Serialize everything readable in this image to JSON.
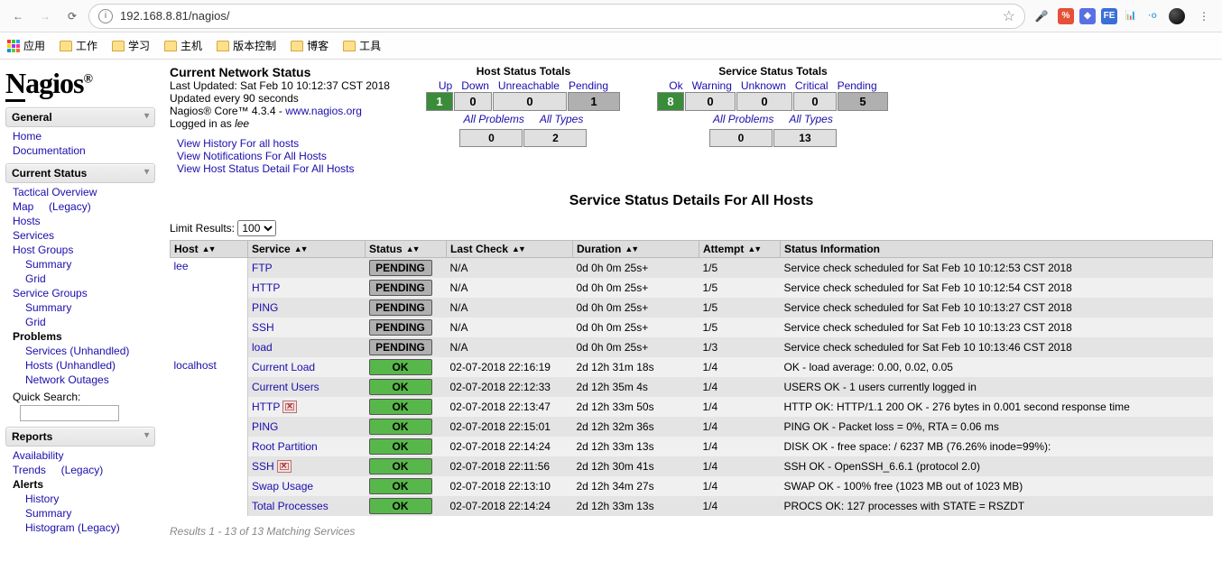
{
  "browser": {
    "url": "192.168.8.81/nagios/",
    "bookmark_label": "应用",
    "bookmarks": [
      "工作",
      "学习",
      "主机",
      "版本控制",
      "博客",
      "工具"
    ]
  },
  "logo": "Nagios",
  "nav": {
    "general": {
      "title": "General",
      "items": [
        "Home",
        "Documentation"
      ]
    },
    "current": {
      "title": "Current Status",
      "items": [
        {
          "label": "Tactical Overview"
        },
        {
          "label": "Map     (Legacy)"
        },
        {
          "label": "Hosts"
        },
        {
          "label": "Services"
        },
        {
          "label": "Host Groups"
        },
        {
          "label": "Summary",
          "sub": true
        },
        {
          "label": "Grid",
          "sub": true
        },
        {
          "label": "Service Groups"
        },
        {
          "label": "Summary",
          "sub": true
        },
        {
          "label": "Grid",
          "sub": true
        },
        {
          "label": "Problems",
          "bold": true
        },
        {
          "label": "Services (Unhandled)",
          "sub": true
        },
        {
          "label": "Hosts (Unhandled)",
          "sub": true
        },
        {
          "label": "Network Outages",
          "sub": true
        }
      ],
      "quick_search": "Quick Search:"
    },
    "reports": {
      "title": "Reports",
      "items": [
        {
          "label": "Availability"
        },
        {
          "label": "Trends     (Legacy)"
        },
        {
          "label": "Alerts",
          "bold": true
        },
        {
          "label": "History",
          "sub": true
        },
        {
          "label": "Summary",
          "sub": true
        },
        {
          "label": "Histogram (Legacy)",
          "sub": true
        }
      ]
    }
  },
  "cns": {
    "title": "Current Network Status",
    "last_updated": "Last Updated: Sat Feb 10 10:12:37 CST 2018",
    "interval": "Updated every 90 seconds",
    "core_prefix": "Nagios® Core™ 4.3.4 - ",
    "core_link": "www.nagios.org",
    "loggedin_prefix": "Logged in as ",
    "loggedin_user": "lee",
    "links": [
      "View History For all hosts",
      "View Notifications For All Hosts",
      "View Host Status Detail For All Hosts"
    ]
  },
  "host_totals": {
    "title": "Host Status Totals",
    "headers": [
      "Up",
      "Down",
      "Unreachable",
      "Pending"
    ],
    "values": [
      "1",
      "0",
      "0",
      "1"
    ],
    "sub_headers": [
      "All Problems",
      "All Types"
    ],
    "sub_values": [
      "0",
      "2"
    ]
  },
  "service_totals": {
    "title": "Service Status Totals",
    "headers": [
      "Ok",
      "Warning",
      "Unknown",
      "Critical",
      "Pending"
    ],
    "values": [
      "8",
      "0",
      "0",
      "0",
      "5"
    ],
    "sub_headers": [
      "All Problems",
      "All Types"
    ],
    "sub_values": [
      "0",
      "13"
    ]
  },
  "details_title": "Service Status Details For All Hosts",
  "limit_label": "Limit Results:",
  "limit_value": "100",
  "columns": [
    "Host",
    "Service",
    "Status",
    "Last Check",
    "Duration",
    "Attempt",
    "Status Information"
  ],
  "rows": [
    {
      "host": "lee",
      "service": "FTP",
      "status": "PENDING",
      "lastcheck": "N/A",
      "duration": "0d 0h 0m 25s+",
      "attempt": "1/5",
      "info": "Service check scheduled for Sat Feb 10 10:12:53 CST 2018"
    },
    {
      "host": "",
      "service": "HTTP",
      "status": "PENDING",
      "lastcheck": "N/A",
      "duration": "0d 0h 0m 25s+",
      "attempt": "1/5",
      "info": "Service check scheduled for Sat Feb 10 10:12:54 CST 2018"
    },
    {
      "host": "",
      "service": "PING",
      "status": "PENDING",
      "lastcheck": "N/A",
      "duration": "0d 0h 0m 25s+",
      "attempt": "1/5",
      "info": "Service check scheduled for Sat Feb 10 10:13:27 CST 2018"
    },
    {
      "host": "",
      "service": "SSH",
      "status": "PENDING",
      "lastcheck": "N/A",
      "duration": "0d 0h 0m 25s+",
      "attempt": "1/5",
      "info": "Service check scheduled for Sat Feb 10 10:13:23 CST 2018"
    },
    {
      "host": "",
      "service": "load",
      "status": "PENDING",
      "lastcheck": "N/A",
      "duration": "0d 0h 0m 25s+",
      "attempt": "1/3",
      "info": "Service check scheduled for Sat Feb 10 10:13:46 CST 2018"
    },
    {
      "host": "localhost",
      "service": "Current Load",
      "status": "OK",
      "lastcheck": "02-07-2018 22:16:19",
      "duration": "2d 12h 31m 18s",
      "attempt": "1/4",
      "info": "OK - load average: 0.00, 0.02, 0.05"
    },
    {
      "host": "",
      "service": "Current Users",
      "status": "OK",
      "lastcheck": "02-07-2018 22:12:33",
      "duration": "2d 12h 35m 4s",
      "attempt": "1/4",
      "info": "USERS OK - 1 users currently logged in"
    },
    {
      "host": "",
      "service": "HTTP",
      "status": "OK",
      "icon": true,
      "lastcheck": "02-07-2018 22:13:47",
      "duration": "2d 12h 33m 50s",
      "attempt": "1/4",
      "info": "HTTP OK: HTTP/1.1 200 OK - 276 bytes in 0.001 second response time"
    },
    {
      "host": "",
      "service": "PING",
      "status": "OK",
      "lastcheck": "02-07-2018 22:15:01",
      "duration": "2d 12h 32m 36s",
      "attempt": "1/4",
      "info": "PING OK - Packet loss = 0%, RTA = 0.06 ms"
    },
    {
      "host": "",
      "service": "Root Partition",
      "status": "OK",
      "lastcheck": "02-07-2018 22:14:24",
      "duration": "2d 12h 33m 13s",
      "attempt": "1/4",
      "info": "DISK OK - free space: / 6237 MB (76.26% inode=99%):"
    },
    {
      "host": "",
      "service": "SSH",
      "status": "OK",
      "icon": true,
      "lastcheck": "02-07-2018 22:11:56",
      "duration": "2d 12h 30m 41s",
      "attempt": "1/4",
      "info": "SSH OK - OpenSSH_6.6.1 (protocol 2.0)"
    },
    {
      "host": "",
      "service": "Swap Usage",
      "status": "OK",
      "lastcheck": "02-07-2018 22:13:10",
      "duration": "2d 12h 34m 27s",
      "attempt": "1/4",
      "info": "SWAP OK - 100% free (1023 MB out of 1023 MB)"
    },
    {
      "host": "",
      "service": "Total Processes",
      "status": "OK",
      "lastcheck": "02-07-2018 22:14:24",
      "duration": "2d 12h 33m 13s",
      "attempt": "1/4",
      "info": "PROCS OK: 127 processes with STATE = RSZDT"
    }
  ],
  "results_text": "Results 1 - 13 of 13 Matching Services"
}
